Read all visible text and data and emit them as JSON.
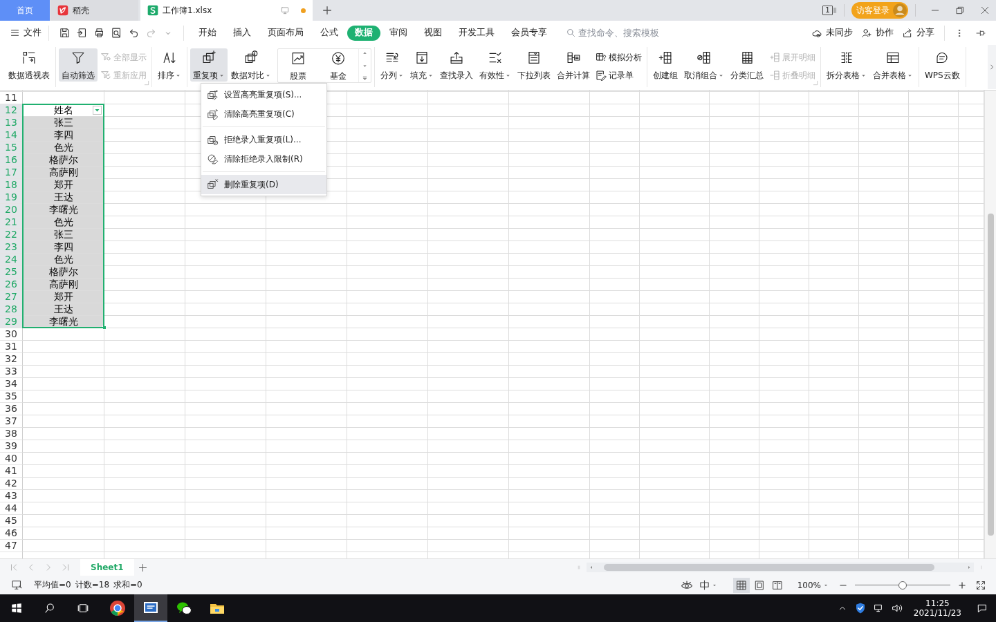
{
  "title_bar": {
    "tabs": [
      {
        "label": "首页",
        "kind": "home",
        "selected": false
      },
      {
        "label": "稻壳",
        "kind": "docer",
        "selected": false
      },
      {
        "label": "工作簿1.xlsx",
        "kind": "workbook",
        "selected": true,
        "unsaved": true
      }
    ],
    "window_badge": "1",
    "login_button": "访客登录"
  },
  "menu_bar": {
    "file_menu": "文件",
    "tabs": [
      {
        "label": "开始",
        "selected": false
      },
      {
        "label": "插入",
        "selected": false
      },
      {
        "label": "页面布局",
        "selected": false
      },
      {
        "label": "公式",
        "selected": false
      },
      {
        "label": "数据",
        "selected": true
      },
      {
        "label": "审阅",
        "selected": false
      },
      {
        "label": "视图",
        "selected": false
      },
      {
        "label": "开发工具",
        "selected": false
      },
      {
        "label": "会员专享",
        "selected": false
      }
    ],
    "search": {
      "placeholder": "查找命令、搜索模板"
    },
    "actions": [
      "未同步",
      "协作",
      "分享"
    ]
  },
  "ribbon": {
    "groups": [
      {
        "launcher": false,
        "items": [
          {
            "kind": "large",
            "label": "数据透视表",
            "dropdown": false,
            "pressed": false,
            "disabled": false
          }
        ]
      },
      {
        "launcher": true,
        "items": [
          {
            "kind": "large",
            "label": "自动筛选",
            "dropdown": false,
            "pressed": true,
            "disabled": false
          },
          {
            "kind": "small",
            "label": "全部显示",
            "dropdown": false,
            "pressed": false,
            "disabled": true
          },
          {
            "kind": "small",
            "label": "重新应用",
            "dropdown": false,
            "pressed": false,
            "disabled": true
          }
        ]
      },
      {
        "launcher": false,
        "items": [
          {
            "kind": "large",
            "label": "排序",
            "dropdown": true,
            "pressed": false,
            "disabled": false
          }
        ]
      },
      {
        "launcher": false,
        "items": [
          {
            "kind": "large",
            "label": "重复项",
            "dropdown": true,
            "pressed": true,
            "disabled": false
          },
          {
            "kind": "large",
            "label": "数据对比",
            "dropdown": true,
            "pressed": false,
            "disabled": false
          },
          {
            "kind": "gallery",
            "labels": [
              "股票",
              "基金"
            ]
          }
        ]
      },
      {
        "launcher": false,
        "items": [
          {
            "kind": "large",
            "label": "分列",
            "dropdown": true,
            "pressed": false,
            "disabled": false
          },
          {
            "kind": "large",
            "label": "填充",
            "dropdown": true,
            "pressed": false,
            "disabled": false
          },
          {
            "kind": "large",
            "label": "查找录入",
            "dropdown": false,
            "pressed": false,
            "disabled": false
          },
          {
            "kind": "large",
            "label": "有效性",
            "dropdown": true,
            "pressed": false,
            "disabled": false
          },
          {
            "kind": "large",
            "label": "下拉列表",
            "dropdown": false,
            "pressed": false,
            "disabled": false
          },
          {
            "kind": "large",
            "label": "合并计算",
            "dropdown": false,
            "pressed": false,
            "disabled": false
          },
          {
            "kind": "small",
            "label": "模拟分析",
            "dropdown": false,
            "pressed": false,
            "disabled": false
          },
          {
            "kind": "small",
            "label": "记录单",
            "dropdown": false,
            "pressed": false,
            "disabled": false
          }
        ]
      },
      {
        "launcher": true,
        "items": [
          {
            "kind": "large",
            "label": "创建组",
            "dropdown": false,
            "pressed": false,
            "disabled": false
          },
          {
            "kind": "large",
            "label": "取消组合",
            "dropdown": true,
            "pressed": false,
            "disabled": false
          },
          {
            "kind": "large",
            "label": "分类汇总",
            "dropdown": false,
            "pressed": false,
            "disabled": false
          },
          {
            "kind": "small",
            "label": "展开明细",
            "dropdown": false,
            "pressed": false,
            "disabled": true
          },
          {
            "kind": "small",
            "label": "折叠明细",
            "dropdown": false,
            "pressed": false,
            "disabled": true
          }
        ]
      },
      {
        "launcher": false,
        "items": [
          {
            "kind": "large",
            "label": "拆分表格",
            "dropdown": true,
            "pressed": false,
            "disabled": false
          },
          {
            "kind": "large",
            "label": "合并表格",
            "dropdown": true,
            "pressed": false,
            "disabled": false
          }
        ]
      },
      {
        "launcher": false,
        "items": [
          {
            "kind": "large",
            "label": "WPS云数",
            "dropdown": false,
            "pressed": false,
            "disabled": false
          }
        ]
      }
    ]
  },
  "duplicates_menu": {
    "items": [
      {
        "kind": "item",
        "label": "设置高亮重复项(S)...",
        "selected": false
      },
      {
        "kind": "item",
        "label": "清除高亮重复项(C)",
        "selected": false
      },
      {
        "kind": "separator"
      },
      {
        "kind": "item",
        "label": "拒绝录入重复项(L)...",
        "selected": false
      },
      {
        "kind": "item",
        "label": "清除拒绝录入限制(R)",
        "selected": false
      },
      {
        "kind": "separator"
      },
      {
        "kind": "item",
        "label": "删除重复项(D)",
        "selected": true
      }
    ]
  },
  "sheet": {
    "rows": [
      {
        "number": "11",
        "selected": false,
        "active": false,
        "filter_button": false
      },
      {
        "number": "12",
        "selected": true,
        "active": true,
        "filter_button": true,
        "value": "姓名"
      },
      {
        "number": "13",
        "selected": true,
        "active": false,
        "filter_button": false,
        "value": "张三"
      },
      {
        "number": "14",
        "selected": true,
        "active": false,
        "filter_button": false,
        "value": "李四"
      },
      {
        "number": "15",
        "selected": true,
        "active": false,
        "filter_button": false,
        "value": "色光"
      },
      {
        "number": "16",
        "selected": true,
        "active": false,
        "filter_button": false,
        "value": "格萨尔"
      },
      {
        "number": "17",
        "selected": true,
        "active": false,
        "filter_button": false,
        "value": "高萨刚"
      },
      {
        "number": "18",
        "selected": true,
        "active": false,
        "filter_button": false,
        "value": "郑开"
      },
      {
        "number": "19",
        "selected": true,
        "active": false,
        "filter_button": false,
        "value": "王达"
      },
      {
        "number": "20",
        "selected": true,
        "active": false,
        "filter_button": false,
        "value": "李曙光"
      },
      {
        "number": "21",
        "selected": true,
        "active": false,
        "filter_button": false,
        "value": "色光"
      },
      {
        "number": "22",
        "selected": true,
        "active": false,
        "filter_button": false,
        "value": "张三"
      },
      {
        "number": "23",
        "selected": true,
        "active": false,
        "filter_button": false,
        "value": "李四"
      },
      {
        "number": "24",
        "selected": true,
        "active": false,
        "filter_button": false,
        "value": "色光"
      },
      {
        "number": "25",
        "selected": true,
        "active": false,
        "filter_button": false,
        "value": "格萨尔"
      },
      {
        "number": "26",
        "selected": true,
        "active": false,
        "filter_button": false,
        "value": "高萨刚"
      },
      {
        "number": "27",
        "selected": true,
        "active": false,
        "filter_button": false,
        "value": "郑开"
      },
      {
        "number": "28",
        "selected": true,
        "active": false,
        "filter_button": false,
        "value": "王达"
      },
      {
        "number": "29",
        "selected": true,
        "active": false,
        "filter_button": false,
        "value": "李曙光"
      },
      {
        "number": "30",
        "selected": false,
        "active": false,
        "filter_button": false
      },
      {
        "number": "31",
        "selected": false,
        "active": false,
        "filter_button": false
      },
      {
        "number": "32",
        "selected": false,
        "active": false,
        "filter_button": false
      },
      {
        "number": "33",
        "selected": false,
        "active": false,
        "filter_button": false
      },
      {
        "number": "34",
        "selected": false,
        "active": false,
        "filter_button": false
      },
      {
        "number": "35",
        "selected": false,
        "active": false,
        "filter_button": false
      },
      {
        "number": "36",
        "selected": false,
        "active": false,
        "filter_button": false
      },
      {
        "number": "37",
        "selected": false,
        "active": false,
        "filter_button": false
      },
      {
        "number": "38",
        "selected": false,
        "active": false,
        "filter_button": false
      },
      {
        "number": "39",
        "selected": false,
        "active": false,
        "filter_button": false
      },
      {
        "number": "40",
        "selected": false,
        "active": false,
        "filter_button": false
      },
      {
        "number": "41",
        "selected": false,
        "active": false,
        "filter_button": false
      },
      {
        "number": "42",
        "selected": false,
        "active": false,
        "filter_button": false
      },
      {
        "number": "43",
        "selected": false,
        "active": false,
        "filter_button": false
      },
      {
        "number": "44",
        "selected": false,
        "active": false,
        "filter_button": false
      },
      {
        "number": "45",
        "selected": false,
        "active": false,
        "filter_button": false
      },
      {
        "number": "46",
        "selected": false,
        "active": false,
        "filter_button": false
      },
      {
        "number": "47",
        "selected": false,
        "active": false,
        "filter_button": false
      }
    ]
  },
  "sheet_tabs": {
    "tabs": [
      {
        "label": "Sheet1",
        "selected": true
      }
    ]
  },
  "status_bar": {
    "stats": [
      "平均值=0",
      "计数=18",
      "求和=0"
    ],
    "view_modes": [
      {
        "selected": true
      },
      {
        "selected": false
      },
      {
        "selected": false
      }
    ],
    "zoom": "100%",
    "zoom_slider": {
      "level": 0.5
    }
  },
  "taskbar": {
    "apps": [
      {
        "kind": "browser",
        "selected": false
      },
      {
        "kind": "wps",
        "selected": true
      },
      {
        "kind": "chat",
        "selected": false
      },
      {
        "kind": "folder",
        "selected": false
      }
    ],
    "clock": {
      "time": "11:25",
      "date": "2021/11/23"
    }
  }
}
